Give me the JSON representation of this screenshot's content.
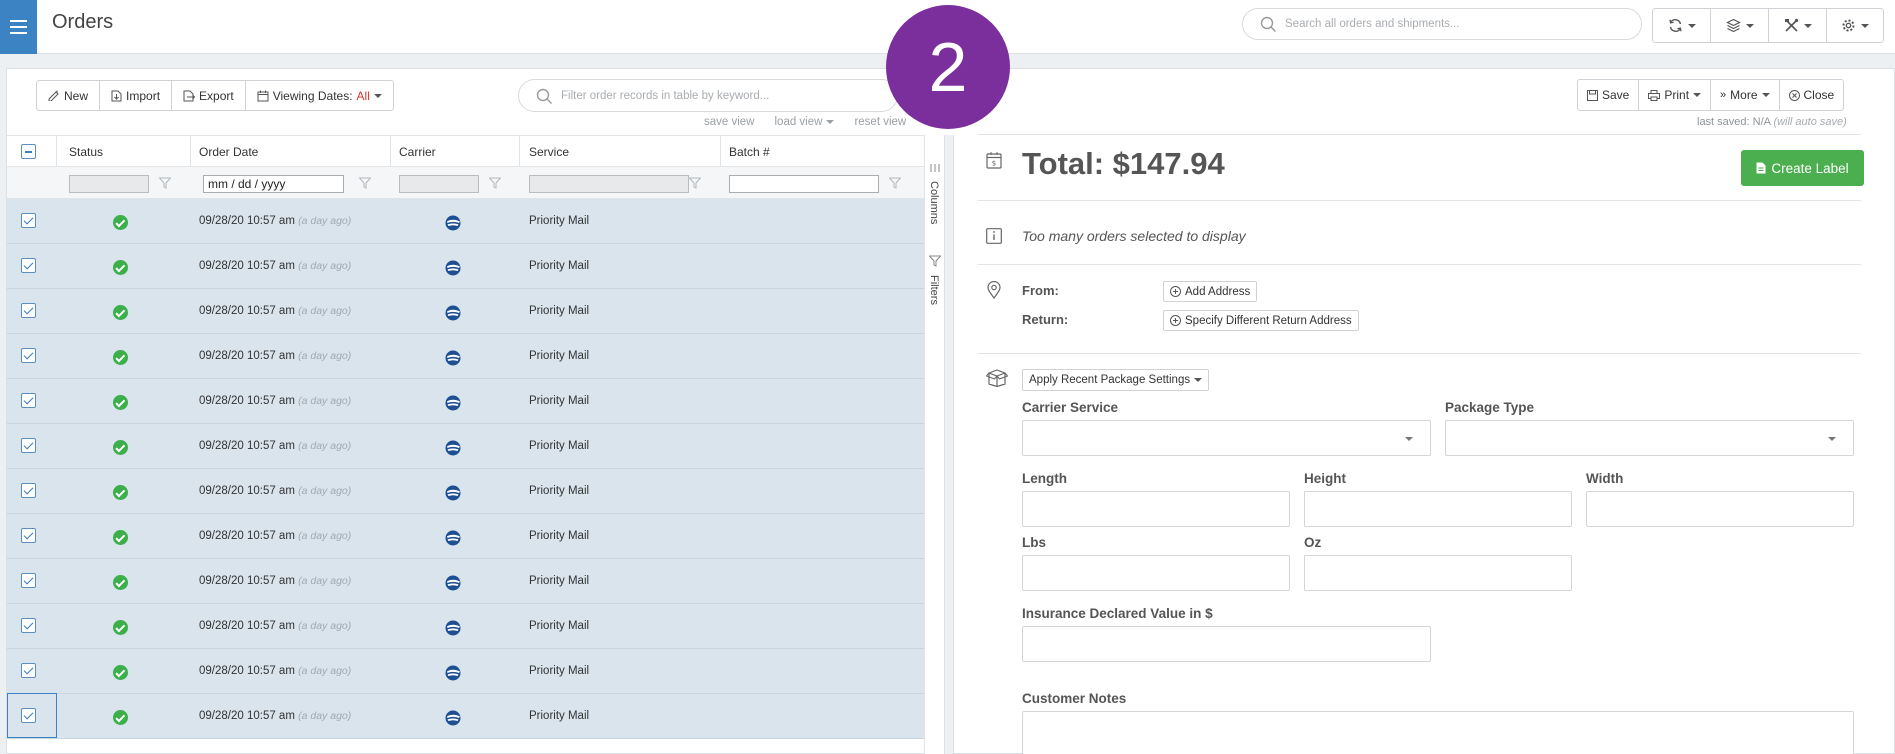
{
  "header": {
    "title": "Orders",
    "search_placeholder": "Search all orders and shipments..."
  },
  "toolbar": {
    "new_label": "New",
    "import_label": "Import",
    "export_label": "Export",
    "viewing_dates_label": "Viewing Dates:",
    "viewing_dates_value": "All",
    "filter_placeholder": "Filter order records in table by keyword...",
    "save_view": "save view",
    "load_view": "load view",
    "reset_view": "reset view"
  },
  "table": {
    "columns": [
      "Status",
      "Order Date",
      "Carrier",
      "Service",
      "Batch #"
    ],
    "date_filter_value": "mm / dd / yyyy",
    "rows": [
      {
        "date": "09/28/20 10:57 am",
        "ago": "(a day ago)",
        "service": "Priority Mail"
      },
      {
        "date": "09/28/20 10:57 am",
        "ago": "(a day ago)",
        "service": "Priority Mail"
      },
      {
        "date": "09/28/20 10:57 am",
        "ago": "(a day ago)",
        "service": "Priority Mail"
      },
      {
        "date": "09/28/20 10:57 am",
        "ago": "(a day ago)",
        "service": "Priority Mail"
      },
      {
        "date": "09/28/20 10:57 am",
        "ago": "(a day ago)",
        "service": "Priority Mail"
      },
      {
        "date": "09/28/20 10:57 am",
        "ago": "(a day ago)",
        "service": "Priority Mail"
      },
      {
        "date": "09/28/20 10:57 am",
        "ago": "(a day ago)",
        "service": "Priority Mail"
      },
      {
        "date": "09/28/20 10:57 am",
        "ago": "(a day ago)",
        "service": "Priority Mail"
      },
      {
        "date": "09/28/20 10:57 am",
        "ago": "(a day ago)",
        "service": "Priority Mail"
      },
      {
        "date": "09/28/20 10:57 am",
        "ago": "(a day ago)",
        "service": "Priority Mail"
      },
      {
        "date": "09/28/20 10:57 am",
        "ago": "(a day ago)",
        "service": "Priority Mail"
      },
      {
        "date": "09/28/20 10:57 am",
        "ago": "(a day ago)",
        "service": "Priority Mail"
      }
    ]
  },
  "sidetabs": {
    "columns": "Columns",
    "filters": "Filters"
  },
  "right": {
    "save_label": "Save",
    "print_label": "Print",
    "more_label": "More",
    "close_label": "Close",
    "last_saved": "last saved: N/A",
    "auto_save": "(will auto save)",
    "total": "Total: $147.94",
    "create_label": "Create Label",
    "too_many": "Too many orders selected to display",
    "from_label": "From:",
    "return_label": "Return:",
    "add_address": "Add Address",
    "specify_return": "Specify Different Return Address",
    "apply_recent": "Apply Recent Package Settings",
    "carrier_service": "Carrier Service",
    "package_type": "Package Type",
    "length": "Length",
    "height": "Height",
    "width": "Width",
    "lbs": "Lbs",
    "oz": "Oz",
    "insurance": "Insurance Declared Value in $",
    "customer_notes": "Customer Notes"
  },
  "badge": "2",
  "colors": {
    "accent": "#3b83c2",
    "success": "#4bae4f",
    "badge": "#7b2f9c",
    "row_selected": "#d9e4ed"
  }
}
